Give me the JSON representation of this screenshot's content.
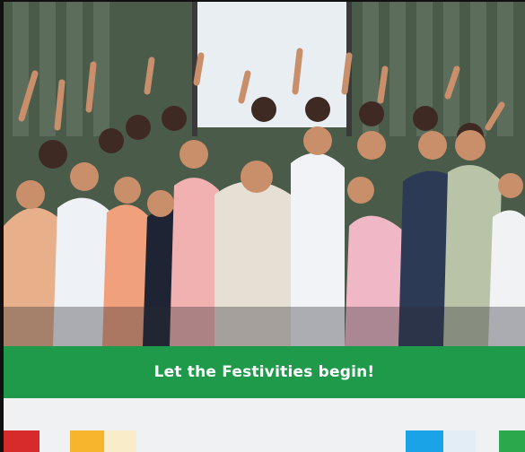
{
  "image": {
    "description_icon": "group-celebration-photo"
  },
  "banner": {
    "text": "Let the Festivities begin!",
    "color": "#1f9a4a"
  },
  "bottom_tiles": {
    "colors": [
      "#d72b2b",
      "#f6b52c",
      "#f8edc8",
      "#1aa3e6",
      "#e2edf5",
      "#2ca84c"
    ]
  }
}
